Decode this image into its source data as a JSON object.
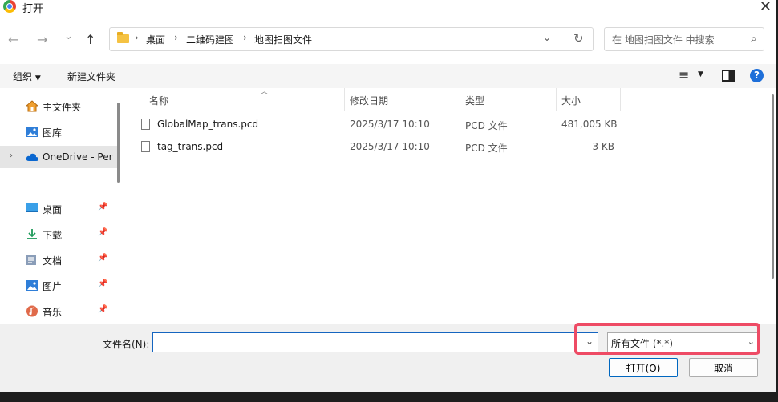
{
  "window": {
    "title": "打开"
  },
  "nav": {
    "back": "←",
    "forward": "→",
    "recent": "⌄",
    "up": "↑",
    "breadcrumbs": [
      "桌面",
      "二维码建图",
      "地图扫图文件"
    ],
    "search_placeholder": "在 地图扫图文件 中搜索"
  },
  "toolbar": {
    "organize": "组织",
    "new_folder": "新建文件夹"
  },
  "sidebar": {
    "quick": [
      {
        "label": "主文件夹",
        "icon": "home-icon"
      },
      {
        "label": "图库",
        "icon": "gallery-icon"
      },
      {
        "label": "OneDrive - Per",
        "icon": "cloud-icon"
      }
    ],
    "pinned": [
      {
        "label": "桌面",
        "icon": "desktop-icon"
      },
      {
        "label": "下载",
        "icon": "download-icon"
      },
      {
        "label": "文档",
        "icon": "documents-icon"
      },
      {
        "label": "图片",
        "icon": "pictures-icon"
      },
      {
        "label": "音乐",
        "icon": "music-icon"
      }
    ]
  },
  "columns": {
    "name": "名称",
    "date": "修改日期",
    "type": "类型",
    "size": "大小"
  },
  "files": [
    {
      "name": "GlobalMap_trans.pcd",
      "date": "2025/3/17 10:10",
      "type": "PCD 文件",
      "size": "481,005 KB"
    },
    {
      "name": "tag_trans.pcd",
      "date": "2025/3/17 10:10",
      "type": "PCD 文件",
      "size": "3 KB"
    }
  ],
  "bottom": {
    "filename_label": "文件名(N):",
    "filename_value": "",
    "filetype": "所有文件 (*.*)",
    "open_label": "打开(O)",
    "cancel_label": "取消"
  },
  "colors": {
    "accent": "#1565c0",
    "highlight": "#ee4b65"
  }
}
